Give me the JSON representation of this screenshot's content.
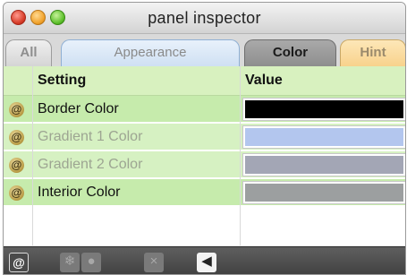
{
  "window": {
    "title": "panel inspector"
  },
  "tabs": [
    {
      "label": "All"
    },
    {
      "label": "Appearance"
    },
    {
      "label": "Color"
    },
    {
      "label": "Hint"
    }
  ],
  "table": {
    "columns": [
      "Setting",
      "Value"
    ],
    "rows": [
      {
        "badge": "@",
        "label": "Border Color",
        "value_color": "#000000",
        "enabled": true
      },
      {
        "badge": "@",
        "label": "Gradient 1 Color",
        "value_color": "#b3c6ee",
        "enabled": false
      },
      {
        "badge": "@",
        "label": "Gradient 2 Color",
        "value_color": "#a3a6b5",
        "enabled": false
      },
      {
        "badge": "@",
        "label": "Interior Color",
        "value_color": "#9c9fa0",
        "enabled": true
      }
    ]
  },
  "toolbar": {
    "at_label": "@",
    "icons": [
      "at-icon",
      "snowflake-icon",
      "gear-icon",
      "delete-icon",
      "back-arrow-icon"
    ]
  },
  "colors": {
    "header_green": "#d8f1bf",
    "row_green": "#c6ebac",
    "toolbar_dark": "#4f4f4f"
  }
}
